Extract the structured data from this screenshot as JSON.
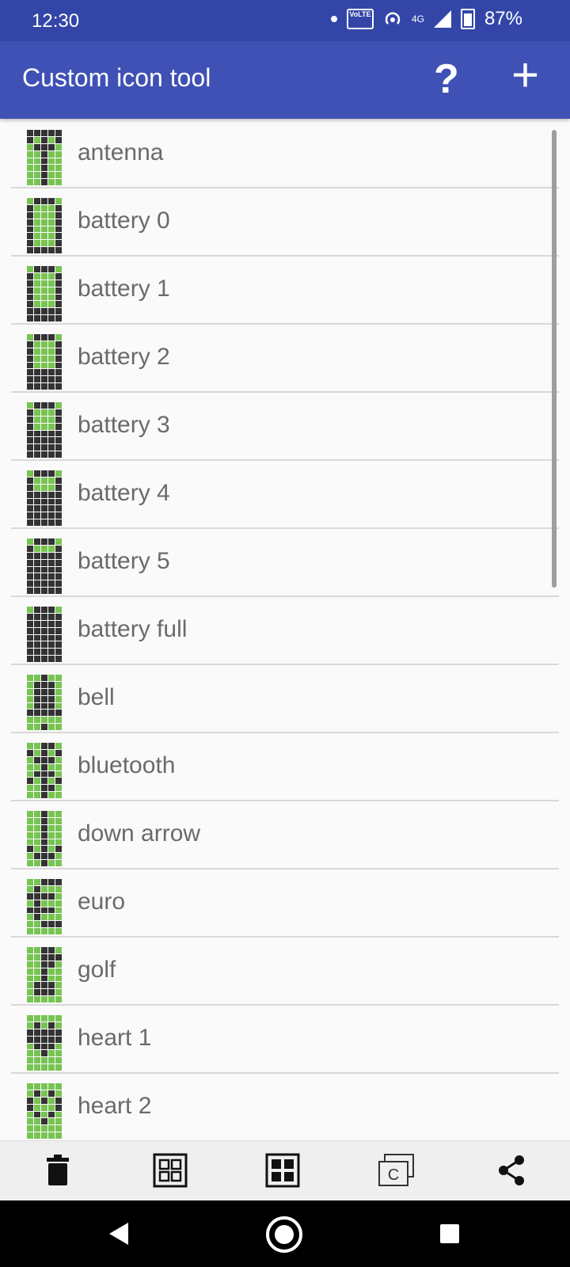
{
  "status": {
    "time": "12:30",
    "volte": "VoLTE",
    "network": "4G",
    "battery": "87%"
  },
  "appbar": {
    "title": "Custom icon tool",
    "help_label": "?",
    "add_label": "+"
  },
  "items": [
    {
      "name": "antenna",
      "pattern": [
        "11111",
        "10101",
        "01110",
        "00100",
        "00100",
        "00100",
        "00100",
        "00100"
      ]
    },
    {
      "name": "battery 0",
      "pattern": [
        "01110",
        "10001",
        "10001",
        "10001",
        "10001",
        "10001",
        "10001",
        "11111"
      ]
    },
    {
      "name": "battery 1",
      "pattern": [
        "01110",
        "10001",
        "10001",
        "10001",
        "10001",
        "10001",
        "11111",
        "11111"
      ]
    },
    {
      "name": "battery 2",
      "pattern": [
        "01110",
        "10001",
        "10001",
        "10001",
        "10001",
        "11111",
        "11111",
        "11111"
      ]
    },
    {
      "name": "battery 3",
      "pattern": [
        "01110",
        "10001",
        "10001",
        "10001",
        "11111",
        "11111",
        "11111",
        "11111"
      ]
    },
    {
      "name": "battery 4",
      "pattern": [
        "01110",
        "10001",
        "10001",
        "11111",
        "11111",
        "11111",
        "11111",
        "11111"
      ]
    },
    {
      "name": "battery 5",
      "pattern": [
        "01110",
        "10001",
        "11111",
        "11111",
        "11111",
        "11111",
        "11111",
        "11111"
      ]
    },
    {
      "name": "battery full",
      "pattern": [
        "01110",
        "11111",
        "11111",
        "11111",
        "11111",
        "11111",
        "11111",
        "11111"
      ]
    },
    {
      "name": "bell",
      "pattern": [
        "00100",
        "01110",
        "01110",
        "01110",
        "01110",
        "11111",
        "00000",
        "00100"
      ]
    },
    {
      "name": "bluetooth",
      "pattern": [
        "00110",
        "10101",
        "01110",
        "00100",
        "01110",
        "10101",
        "00110",
        "00100"
      ]
    },
    {
      "name": "down arrow",
      "pattern": [
        "00100",
        "00100",
        "00100",
        "00100",
        "00100",
        "10101",
        "01110",
        "00100"
      ]
    },
    {
      "name": "euro",
      "pattern": [
        "00111",
        "01000",
        "11110",
        "01000",
        "11110",
        "01000",
        "00111",
        "00000"
      ]
    },
    {
      "name": "golf",
      "pattern": [
        "00110",
        "00111",
        "00110",
        "00100",
        "00100",
        "01110",
        "01110",
        "00000"
      ]
    },
    {
      "name": "heart 1",
      "pattern": [
        "00000",
        "01010",
        "11111",
        "11111",
        "01110",
        "00100",
        "00000",
        "00000"
      ]
    },
    {
      "name": "heart 2",
      "pattern": [
        "00000",
        "01010",
        "10101",
        "10001",
        "01010",
        "00100",
        "00000",
        "00000"
      ]
    }
  ],
  "toolbar": [
    {
      "name": "delete-button",
      "icon": "trash-icon"
    },
    {
      "name": "grid-outline-button",
      "icon": "grid-outline-icon"
    },
    {
      "name": "grid-filled-button",
      "icon": "grid-filled-icon"
    },
    {
      "name": "copy-button",
      "icon": "copy-c-icon",
      "label": "C"
    },
    {
      "name": "share-button",
      "icon": "share-icon"
    }
  ],
  "colors": {
    "statusbar": "#3346a8",
    "appbar": "#3f51b5",
    "pixel_on": "#333333",
    "pixel_off": "#78c453"
  }
}
